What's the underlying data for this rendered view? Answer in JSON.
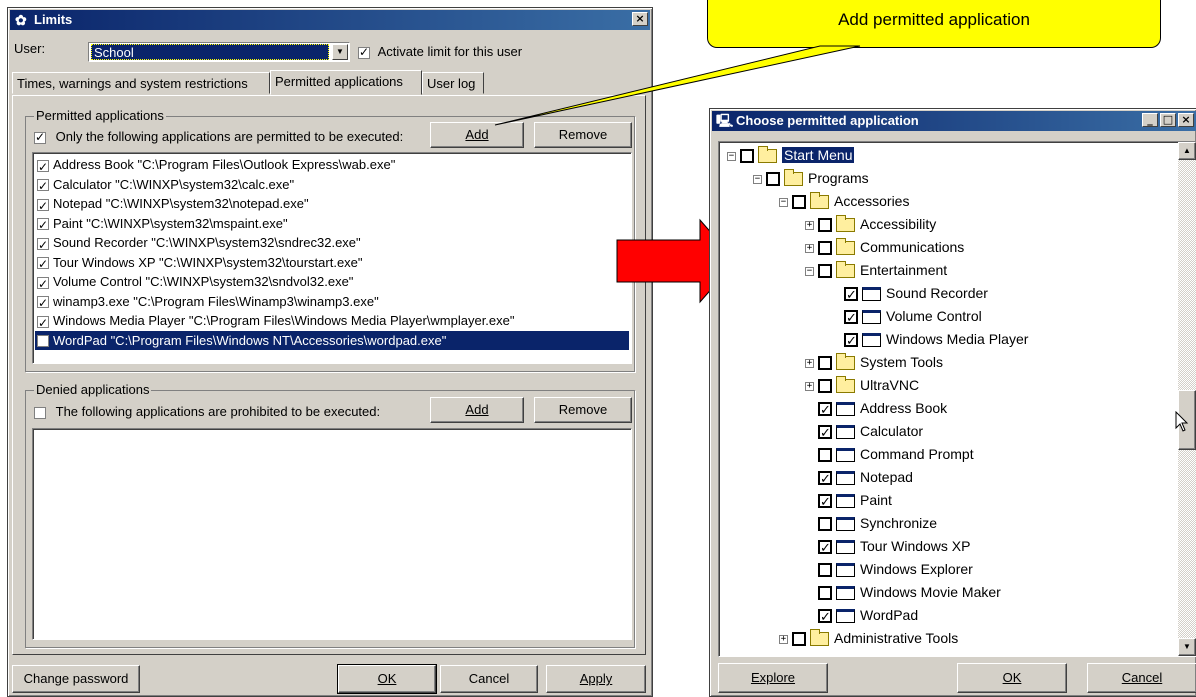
{
  "limits": {
    "title": "Limits",
    "close": "×",
    "user_label": "User:",
    "user_value": "School",
    "activate_label": "Activate limit for this user",
    "tabs": [
      {
        "label": "Times, warnings and system restrictions"
      },
      {
        "label": "Permitted applications"
      },
      {
        "label": "User log"
      }
    ],
    "permitted": {
      "title": "Permitted applications",
      "only_label": "Only the following applications are permitted to be executed:",
      "add": "Add",
      "remove": "Remove",
      "items": [
        "Address Book \"C:\\Program Files\\Outlook Express\\wab.exe\"",
        "Calculator \"C:\\WINXP\\system32\\calc.exe\"",
        "Notepad \"C:\\WINXP\\system32\\notepad.exe\"",
        "Paint \"C:\\WINXP\\system32\\mspaint.exe\"",
        "Sound Recorder \"C:\\WINXP\\system32\\sndrec32.exe\"",
        "Tour Windows XP \"C:\\WINXP\\system32\\tourstart.exe\"",
        "Volume Control \"C:\\WINXP\\system32\\sndvol32.exe\"",
        "winamp3.exe \"C:\\Program Files\\Winamp3\\winamp3.exe\"",
        "Windows Media Player \"C:\\Program Files\\Windows Media Player\\wmplayer.exe\"",
        "WordPad \"C:\\Program Files\\Windows NT\\Accessories\\wordpad.exe\""
      ]
    },
    "denied": {
      "title": "Denied applications",
      "prohibit_label": "The following applications are prohibited to be executed:",
      "add": "Add",
      "remove": "Remove"
    },
    "buttons": {
      "change_password": "Change password",
      "ok": "OK",
      "cancel": "Cancel",
      "apply": "Apply"
    }
  },
  "callout": {
    "text": "Add permitted application",
    "color": "#ffff00"
  },
  "arrow_color": "#ff0000",
  "chooser": {
    "title": "Choose permitted application",
    "min": "_",
    "max": "□",
    "close": "×",
    "tree": [
      {
        "label": "Start Menu",
        "checked": false,
        "icon": "folder-open-icon",
        "expander": "−"
      },
      {
        "label": "Programs",
        "checked": false,
        "icon": "folder-open-icon",
        "expander": "−"
      },
      {
        "label": "Accessories",
        "checked": false,
        "icon": "folder-open-icon",
        "expander": "−"
      },
      {
        "label": "Accessibility",
        "checked": false,
        "icon": "folder-icon",
        "expander": "+"
      },
      {
        "label": "Communications",
        "checked": false,
        "icon": "folder-icon",
        "expander": "+"
      },
      {
        "label": "Entertainment",
        "checked": false,
        "icon": "folder-open-icon",
        "expander": "−"
      },
      {
        "label": "Sound Recorder",
        "checked": true,
        "icon": "application-icon",
        "expander": ""
      },
      {
        "label": "Volume Control",
        "checked": true,
        "icon": "application-icon",
        "expander": ""
      },
      {
        "label": "Windows Media Player",
        "checked": true,
        "icon": "application-icon",
        "expander": ""
      },
      {
        "label": "System Tools",
        "checked": false,
        "icon": "folder-icon",
        "expander": "+"
      },
      {
        "label": "UltraVNC",
        "checked": false,
        "icon": "folder-icon",
        "expander": "+"
      },
      {
        "label": "Address Book",
        "checked": true,
        "icon": "application-icon",
        "expander": ""
      },
      {
        "label": "Calculator",
        "checked": true,
        "icon": "application-icon",
        "expander": ""
      },
      {
        "label": "Command Prompt",
        "checked": false,
        "icon": "application-icon",
        "expander": ""
      },
      {
        "label": "Notepad",
        "checked": true,
        "icon": "application-icon",
        "expander": ""
      },
      {
        "label": "Paint",
        "checked": true,
        "icon": "application-icon",
        "expander": ""
      },
      {
        "label": "Synchronize",
        "checked": false,
        "icon": "application-icon",
        "expander": ""
      },
      {
        "label": "Tour Windows XP",
        "checked": true,
        "icon": "application-icon",
        "expander": ""
      },
      {
        "label": "Windows Explorer",
        "checked": false,
        "icon": "application-icon",
        "expander": ""
      },
      {
        "label": "Windows Movie Maker",
        "checked": false,
        "icon": "application-icon",
        "expander": ""
      },
      {
        "label": "WordPad",
        "checked": true,
        "icon": "application-icon",
        "expander": ""
      },
      {
        "label": "Administrative Tools",
        "checked": false,
        "icon": "folder-icon",
        "expander": "+"
      }
    ],
    "buttons": {
      "explore": "Explore",
      "ok": "OK",
      "cancel": "Cancel"
    }
  }
}
